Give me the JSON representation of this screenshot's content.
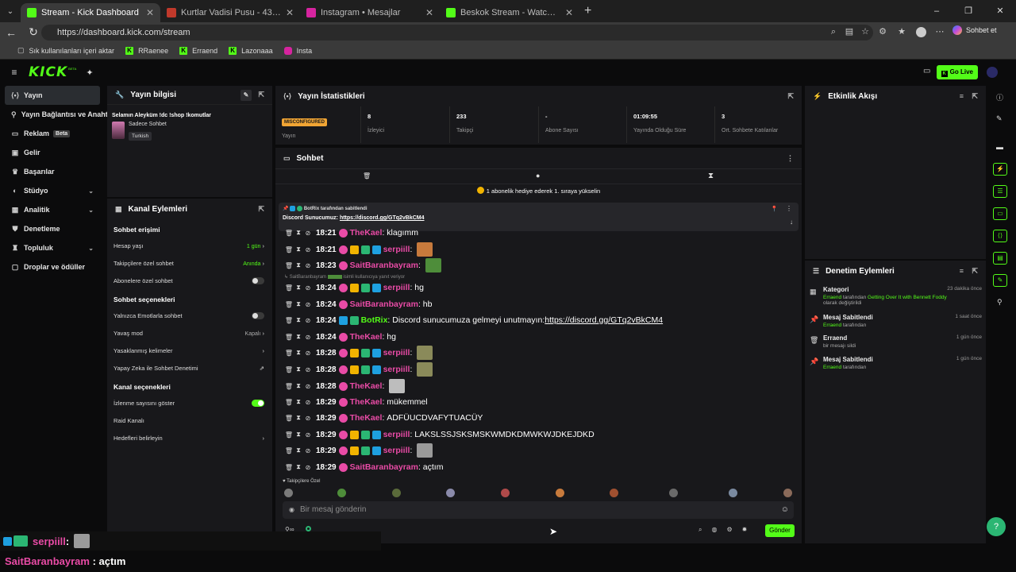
{
  "browser": {
    "tabs": [
      {
        "label": "Stream - Kick Dashboard",
        "active": true,
        "color": "#53fc18"
      },
      {
        "label": "Kurtlar Vadisi Pusu - 43. Bölüm FULL",
        "active": false,
        "color": "#c0392b"
      },
      {
        "label": "Instagram • Mesajlar",
        "active": false,
        "color": "#d6249f"
      },
      {
        "label": "Beskok Stream - Watch Live on Kick",
        "active": false,
        "color": "#53fc18"
      }
    ],
    "url": "https://dashboard.kick.com/stream",
    "profile_label": "Sohbet et",
    "bookmarks": [
      {
        "label": "Sık kullanılanları içeri aktar",
        "icon": "folder-icon"
      },
      {
        "label": "RRaenee",
        "icon": "kick-icon"
      },
      {
        "label": "Erraend",
        "icon": "kick-icon"
      },
      {
        "label": "Lazonaaa",
        "icon": "kick-icon"
      },
      {
        "label": "Insta",
        "icon": "instagram-icon"
      }
    ]
  },
  "header": {
    "logo": "KICK",
    "logo_sup": "BETA",
    "go_live": "Go Live"
  },
  "nav": {
    "items": [
      {
        "label": "Yayın",
        "icon": "stream-icon",
        "active": true
      },
      {
        "label": "Yayın Bağlantısı ve Anahtarı",
        "icon": "key-icon"
      },
      {
        "label": "Reklam",
        "icon": "ad-icon",
        "badge": "Beta"
      },
      {
        "label": "Gelir",
        "icon": "money-icon"
      },
      {
        "label": "Başarılar",
        "icon": "trophy-icon"
      },
      {
        "label": "Stüdyo",
        "icon": "studio-icon",
        "chevron": true
      },
      {
        "label": "Analitik",
        "icon": "chart-icon",
        "chevron": true
      },
      {
        "label": "Denetleme",
        "icon": "shield-icon"
      },
      {
        "label": "Topluluk",
        "icon": "community-icon",
        "chevron": true
      },
      {
        "label": "Droplar ve ödüller",
        "icon": "gift-icon"
      }
    ]
  },
  "stream_info": {
    "title": "Yayın bilgisi",
    "stream_title": "Selamın Aleyküm !dc !shop !komutlar",
    "category": "Sadece Sohbet",
    "language": "Turkish"
  },
  "channel_actions": {
    "title": "Kanal Eylemleri",
    "chat_access": "Sohbet erişimi",
    "account_age": "Hesap yaşı",
    "account_age_val": "1 gün",
    "followers_chat": "Takipçilere özel sohbet",
    "followers_chat_val": "Anında",
    "subs_chat": "Abonelere özel sohbet",
    "chat_options": "Sohbet seçenekleri",
    "emotes_only": "Yalnızca Emotlarla sohbet",
    "slow_mode": "Yavaş mod",
    "slow_mode_val": "Kapalı",
    "banned_words": "Yasaklanmış kelimeler",
    "ai_moderation": "Yapay Zeka ile Sohbet Denetimi",
    "channel_options": "Kanal seçenekleri",
    "show_views": "İzlenme sayısını göster",
    "raid": "Raid Kanalı",
    "goals": "Hedefleri belirleyin"
  },
  "stats": {
    "title": "Yayın İstatistikleri",
    "items": [
      {
        "value": "MISCONFIGURED",
        "label": "Yayın"
      },
      {
        "value": "8",
        "label": "İzleyici"
      },
      {
        "value": "233",
        "label": "Takipçi"
      },
      {
        "value": "-",
        "label": "Abone Sayısı"
      },
      {
        "value": "01:09:55",
        "label": "Yayında Olduğu Süre"
      },
      {
        "value": "3",
        "label": "Ort. Sohbete Katılanlar"
      }
    ]
  },
  "chat": {
    "title": "Sohbet",
    "gift_banner": "1 abonelik hediye ederek 1. sıraya yükselin",
    "pinned_by": "BotRix tarafından sabitlendi",
    "pinned_text": "Discord Sunucumuz: ",
    "pinned_link": "https://discord.gg/GTq2vBkCM4",
    "reply_hint_user": "SaitBaranbayram",
    "reply_hint_text": "isimli kullanıcıya yanıt veriyor",
    "messages": [
      {
        "time": "18:21",
        "user": "TheKael",
        "color": "#e94ba6",
        "text": "klagımm",
        "badges": [
          "bp"
        ]
      },
      {
        "time": "18:21",
        "user": "serpiill",
        "color": "#e94ba6",
        "text": "",
        "badges": [
          "bp",
          "by",
          "bg",
          "bb"
        ],
        "emote": "#c77a3c"
      },
      {
        "time": "18:23",
        "user": "SaitBaranbayram",
        "color": "#e94ba6",
        "text": "",
        "badges": [
          "bp"
        ],
        "emote": "#4e8d3a"
      },
      {
        "time": "18:24",
        "user": "serpiill",
        "color": "#e94ba6",
        "text": "hg",
        "badges": [
          "bp",
          "by",
          "bg",
          "bb"
        ]
      },
      {
        "time": "18:24",
        "user": "SaitBaranbayram",
        "color": "#e94ba6",
        "text": "hb",
        "badges": [
          "bp"
        ]
      },
      {
        "time": "18:24",
        "user": "BotRix",
        "color": "#53fc18",
        "text": "Discord sunucumuza gelmeyi unutmayın: ",
        "link": "https://discord.gg/GTq2vBkCM4",
        "badges": [
          "bb",
          "bg"
        ]
      },
      {
        "time": "18:24",
        "user": "TheKael",
        "color": "#e94ba6",
        "text": "hg",
        "badges": [
          "bp"
        ]
      },
      {
        "time": "18:28",
        "user": "serpiill",
        "color": "#e94ba6",
        "text": "",
        "badges": [
          "bp",
          "by",
          "bg",
          "bb"
        ],
        "emote": "#8a8a5a"
      },
      {
        "time": "18:28",
        "user": "serpiill",
        "color": "#e94ba6",
        "text": "",
        "badges": [
          "bp",
          "by",
          "bg",
          "bb"
        ],
        "emote": "#8a8a5a"
      },
      {
        "time": "18:28",
        "user": "TheKael",
        "color": "#e94ba6",
        "text": "",
        "badges": [
          "bp"
        ],
        "emote": "#bdbdbd"
      },
      {
        "time": "18:29",
        "user": "TheKael",
        "color": "#e94ba6",
        "text": "mükemmel",
        "badges": [
          "bp"
        ]
      },
      {
        "time": "18:29",
        "user": "TheKael",
        "color": "#e94ba6",
        "text": "ADFÜUCDVAFYTUACÜY",
        "badges": [
          "bp"
        ]
      },
      {
        "time": "18:29",
        "user": "serpiill",
        "color": "#e94ba6",
        "text": "LAKSLSSJSKSMSKWMDKDMWKWJDKEJDKD",
        "badges": [
          "bp",
          "by",
          "bg",
          "bb"
        ]
      },
      {
        "time": "18:29",
        "user": "serpiill",
        "color": "#e94ba6",
        "text": "",
        "badges": [
          "bp",
          "by",
          "bg",
          "bb"
        ],
        "emote": "#9a9a9a"
      },
      {
        "time": "18:29",
        "user": "SaitBaranbayram",
        "color": "#e94ba6",
        "text": "açtım",
        "badges": [
          "bp"
        ]
      }
    ],
    "followers_only": "Takipçilere Özel",
    "input_placeholder": "Bir mesaj gönderin",
    "send": "Gönder"
  },
  "activity": {
    "title": "Etkinlik Akışı"
  },
  "moderation": {
    "title": "Denetim Eylemleri",
    "items": [
      {
        "icon": "category-icon",
        "title": "Kategori",
        "actor": "Erraend",
        "mid": " tarafından ",
        "target": "Getting Over It with Bennett Foddy",
        "tail": " olarak değiştirildi",
        "time": "23 dakika önce"
      },
      {
        "icon": "pin-icon",
        "title": "Mesaj Sabitlendi",
        "actor": "Erraend",
        "mid": " tarafından",
        "target": "",
        "tail": "",
        "time": "1 saat önce"
      },
      {
        "icon": "trash-icon",
        "title": "Erraend",
        "actor": "",
        "mid": "bir mesajı sildi",
        "target": "",
        "tail": "",
        "time": "1 gün önce"
      },
      {
        "icon": "pin-icon",
        "title": "Mesaj Sabitlendi",
        "actor": "Erraend",
        "mid": " tarafından",
        "target": "",
        "tail": "",
        "time": "1 gün önce"
      }
    ]
  },
  "overlay": {
    "user1": "serpiill",
    "sep1": " :",
    "user2": "SaitBaranbayram",
    "sep2": " : ",
    "msg2": "açtım"
  }
}
